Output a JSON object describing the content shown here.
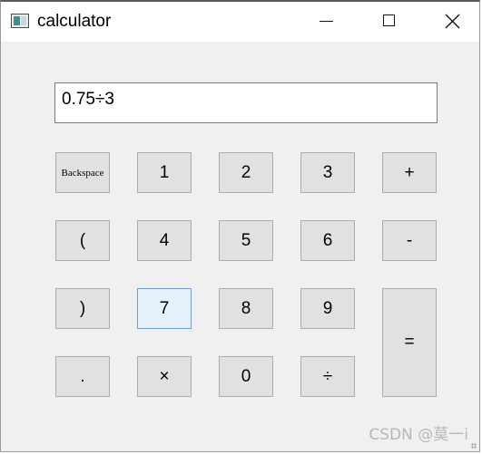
{
  "window": {
    "title": "calculator"
  },
  "display": {
    "value": "0.75÷3"
  },
  "keys": {
    "backspace": "Backspace",
    "one": "1",
    "two": "2",
    "three": "3",
    "plus": "+",
    "lparen": "(",
    "four": "4",
    "five": "5",
    "six": "6",
    "minus": "-",
    "rparen": ")",
    "seven": "7",
    "eight": "8",
    "nine": "9",
    "equals": "=",
    "dot": ".",
    "times": "×",
    "zero": "0",
    "divide": "÷"
  },
  "watermark": "CSDN @莫一i",
  "icons": {
    "app": "app-window-icon",
    "minimize": "minimize-icon",
    "maximize": "maximize-icon",
    "close": "close-icon"
  }
}
